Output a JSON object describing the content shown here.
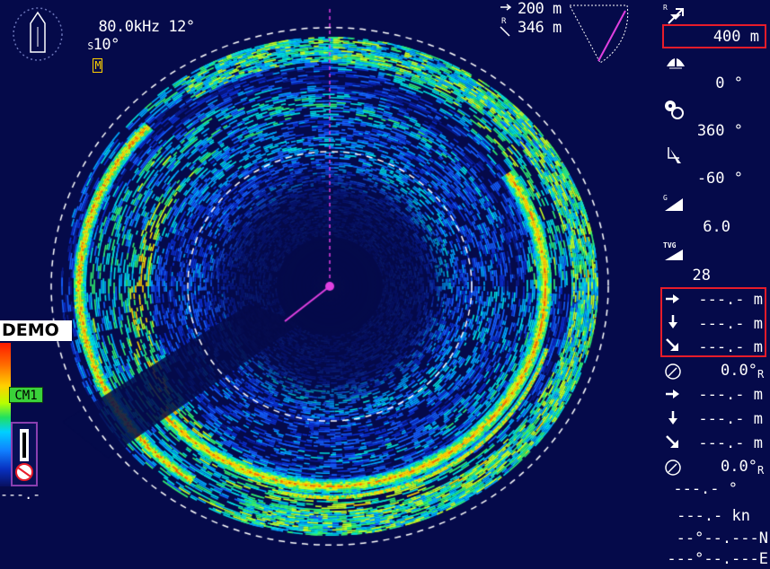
{
  "header": {
    "frequency": "80.0kHz",
    "tilt_top": "12°",
    "tilt_side_prefix": "S",
    "tilt_side": "10°",
    "mark_badge": "M",
    "range_h_value": "200 m",
    "range_s_value": "346 m"
  },
  "right_panel": {
    "range": "400 m",
    "bearing": "0 °",
    "sector": "360 °",
    "tilt": "-60 °",
    "gain": "6.0",
    "tvg": "28",
    "cursor_block_1": {
      "horizontal": "---.- m",
      "depth": "---.- m",
      "slant": "---.- m",
      "bearing": "0.0°",
      "bearing_suffix": "R"
    },
    "cursor_block_2": {
      "horizontal": "---.- m",
      "depth": "---.- m",
      "slant": "---.- m",
      "bearing": "0.0°",
      "bearing_suffix": "R"
    },
    "heading": "---.- °",
    "speed": "---.- kn",
    "latitude": "--°--.---N",
    "longitude": "---°--.---E"
  },
  "left_panel": {
    "demo_label": "DEMO",
    "cm_label": "CM1",
    "bottom_value": "---.-"
  },
  "colors": {
    "background": "#050a4a",
    "accent_magenta": "#e040e0",
    "highlight_red": "#e81c2a",
    "text": "#ffffff"
  },
  "icons": [
    "ship-icon",
    "range-icon",
    "train-icon",
    "sector-icon",
    "tilt-icon",
    "gain-icon",
    "tvg-icon",
    "arrow-right-icon",
    "arrow-down-icon",
    "arrow-diagonal-icon",
    "compass-icon"
  ]
}
